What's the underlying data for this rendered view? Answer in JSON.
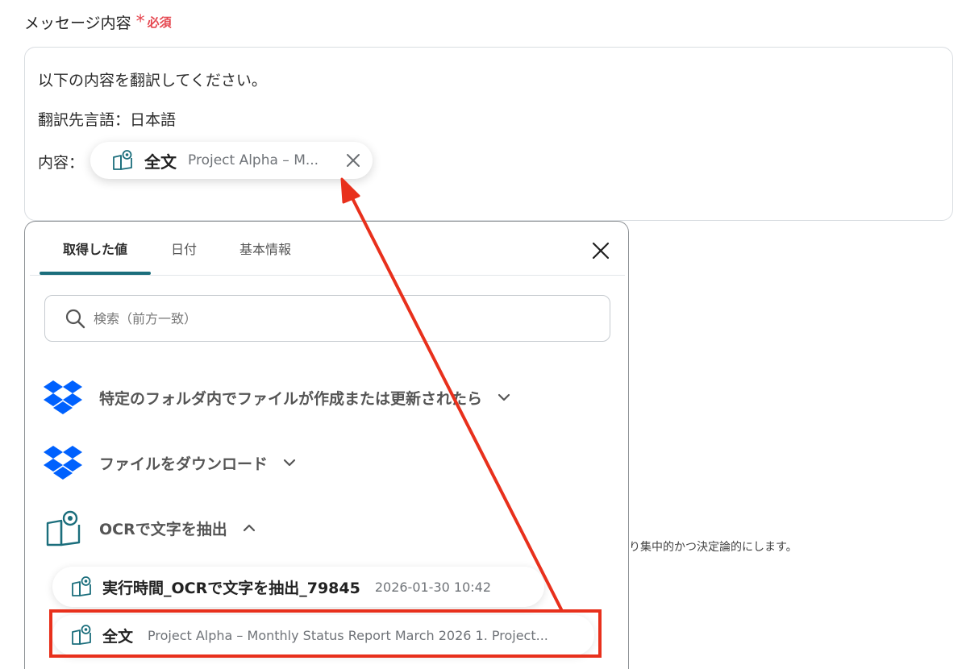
{
  "field": {
    "label": "メッセージ内容",
    "required_star": "*",
    "required_text": "必須"
  },
  "message": {
    "line1": "以下の内容を翻訳してください。",
    "line2": "翻訳先言語：日本語",
    "line3_label": "内容：",
    "chip_label": "全文",
    "chip_value": "Project Alpha – M..."
  },
  "panel": {
    "tabs": [
      {
        "label": "取得した値",
        "active": true
      },
      {
        "label": "日付",
        "active": false
      },
      {
        "label": "基本情報",
        "active": false
      }
    ],
    "search_placeholder": "検索（前方一致）",
    "sections": [
      {
        "label": "特定のフォルダ内でファイルが作成または更新されたら",
        "icon": "dropbox-icon",
        "expanded": false
      },
      {
        "label": "ファイルをダウンロード",
        "icon": "dropbox-icon",
        "expanded": false
      },
      {
        "label": "OCRで文字を抽出",
        "icon": "ocr-book-icon",
        "expanded": true
      }
    ],
    "items": [
      {
        "label": "実行時間_OCRで文字を抽出_79845",
        "value": "2026-01-30 10:42"
      },
      {
        "label": "全文",
        "value": "Project Alpha – Monthly Status Report March 2026 1. Project..."
      }
    ]
  },
  "background_text": "り集中的かつ決定論的にします。",
  "colors": {
    "required": "#e5464f",
    "tab_indicator": "#1b6e7c",
    "dropbox": "#0061fe",
    "annotation": "#e8301c"
  }
}
